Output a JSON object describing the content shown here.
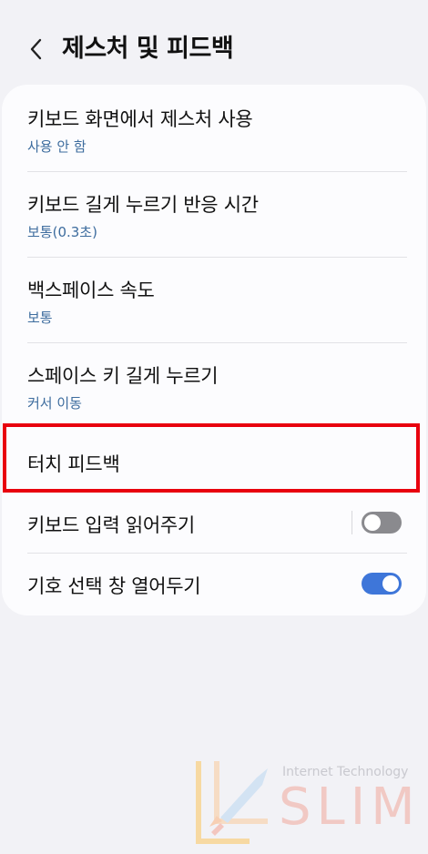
{
  "header": {
    "title": "제스처 및 피드백"
  },
  "settings": {
    "items": [
      {
        "title": "키보드 화면에서 제스처 사용",
        "subtitle": "사용 안 함"
      },
      {
        "title": "키보드 길게 누르기 반응 시간",
        "subtitle": "보통(0.3초)"
      },
      {
        "title": "백스페이스 속도",
        "subtitle": "보통"
      },
      {
        "title": "스페이스 키 길게 누르기",
        "subtitle": "커서 이동"
      },
      {
        "title": "터치 피드백"
      },
      {
        "title": "키보드 입력 읽어주기",
        "toggle": "off"
      },
      {
        "title": "기호 선택 창 열어두기",
        "toggle": "on"
      }
    ]
  },
  "watermark": {
    "caption": "Internet Technology",
    "word": "SLIM"
  },
  "colors": {
    "accent": "#3e76d9",
    "subtitle": "#3d6c9e",
    "highlight_border": "#e8000e",
    "toggle_off": "#8a8a8e"
  }
}
